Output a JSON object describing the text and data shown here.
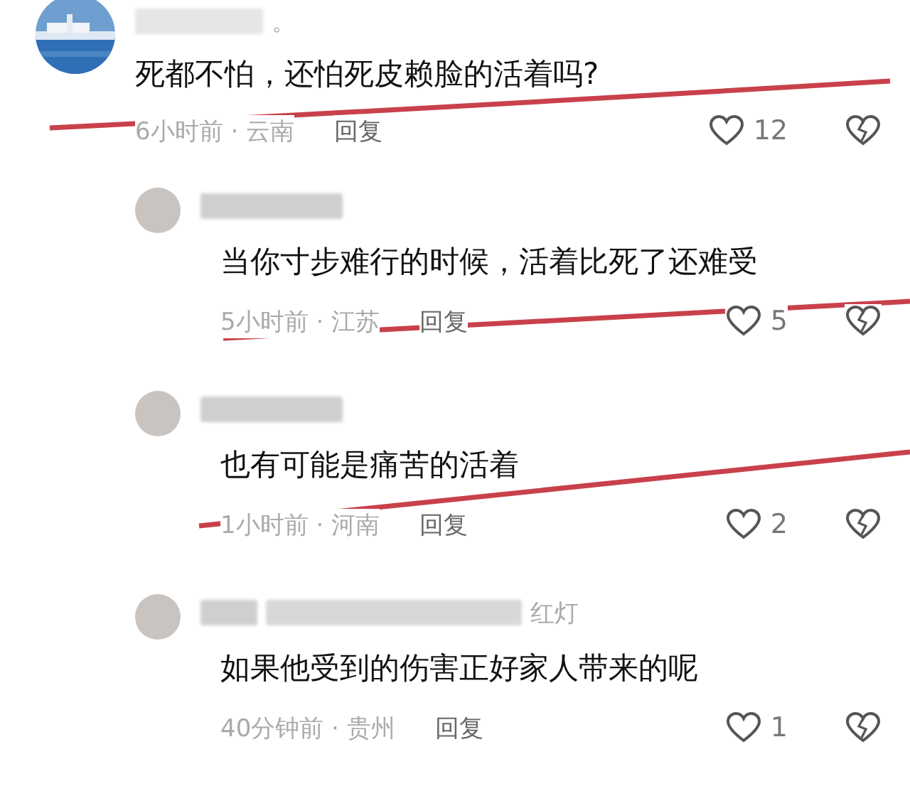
{
  "comments": [
    {
      "kind": "top",
      "name": "。",
      "text": "死都不怕，还怕死皮赖脸的活着吗?",
      "time_location": "6小时前 · 云南",
      "reply": "回复",
      "likes": "12"
    },
    {
      "kind": "reply",
      "text": "当你寸步难行的时候，活着比死了还难受",
      "time_location": "5小时前 · 江苏",
      "reply": "回复",
      "likes": "5"
    },
    {
      "kind": "reply",
      "text": "也有可能是痛苦的活着",
      "time_location": "1小时前 · 河南",
      "reply": "回复",
      "likes": "2"
    },
    {
      "kind": "reply",
      "name": "红灯",
      "text": "如果他受到的伤害正好家人带来的呢",
      "time_location": "40分钟前 · 贵州",
      "reply": "回复",
      "likes": "1"
    }
  ]
}
